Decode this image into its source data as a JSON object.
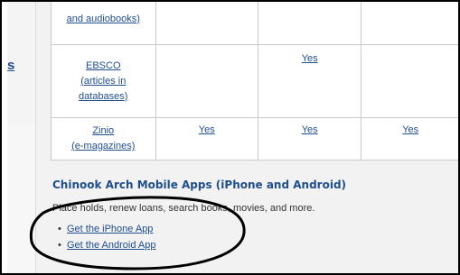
{
  "sidebar": {
    "partial_link": "s"
  },
  "table": {
    "rows": [
      {
        "name_lines": [
          "and audiobooks)"
        ],
        "cells": [
          "",
          "",
          ""
        ]
      },
      {
        "name_lines": [
          "EBSCO",
          "(articles in",
          "databases)"
        ],
        "cells": [
          "",
          "Yes",
          ""
        ]
      },
      {
        "name_lines": [
          "Zinio",
          "(e-magazines)"
        ],
        "cells": [
          "Yes",
          "Yes",
          "Yes"
        ]
      }
    ]
  },
  "mobile_section": {
    "title": "Chinook Arch Mobile Apps (iPhone and Android)",
    "description": "Place holds, renew loans, search books, movies, and more.",
    "links": [
      "Get the iPhone App",
      "Get the Android App"
    ]
  },
  "annotation": {
    "color": "#000000"
  }
}
